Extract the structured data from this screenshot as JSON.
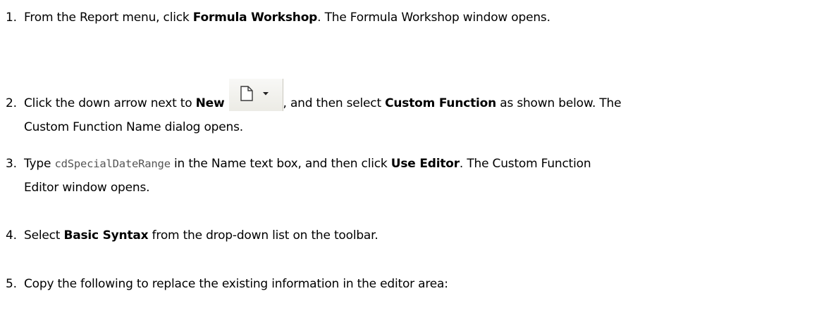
{
  "steps": [
    {
      "number": "1.",
      "parts": [
        "From the Report menu, click ",
        "Formula Workshop",
        ". The Formula Workshop window opens."
      ]
    },
    {
      "number": "2.",
      "parts": [
        "Click the down arrow next to ",
        "New",
        ", and then select ",
        "Custom Function",
        " as shown below. The",
        "Custom Function Name dialog opens."
      ],
      "icons": [
        "new-document-icon",
        "dropdown-arrow-icon"
      ]
    },
    {
      "number": "3.",
      "parts": [
        "Type ",
        "cdSpecialDateRange",
        " in the Name text box, and then click ",
        "Use Editor",
        ". The Custom Function",
        "Editor window opens."
      ]
    },
    {
      "number": "4.",
      "parts": [
        "Select ",
        "Basic Syntax",
        " from the drop-down list on the toolbar."
      ]
    },
    {
      "number": "5.",
      "parts": [
        "Copy the following to replace the existing information in the editor area:"
      ]
    }
  ]
}
